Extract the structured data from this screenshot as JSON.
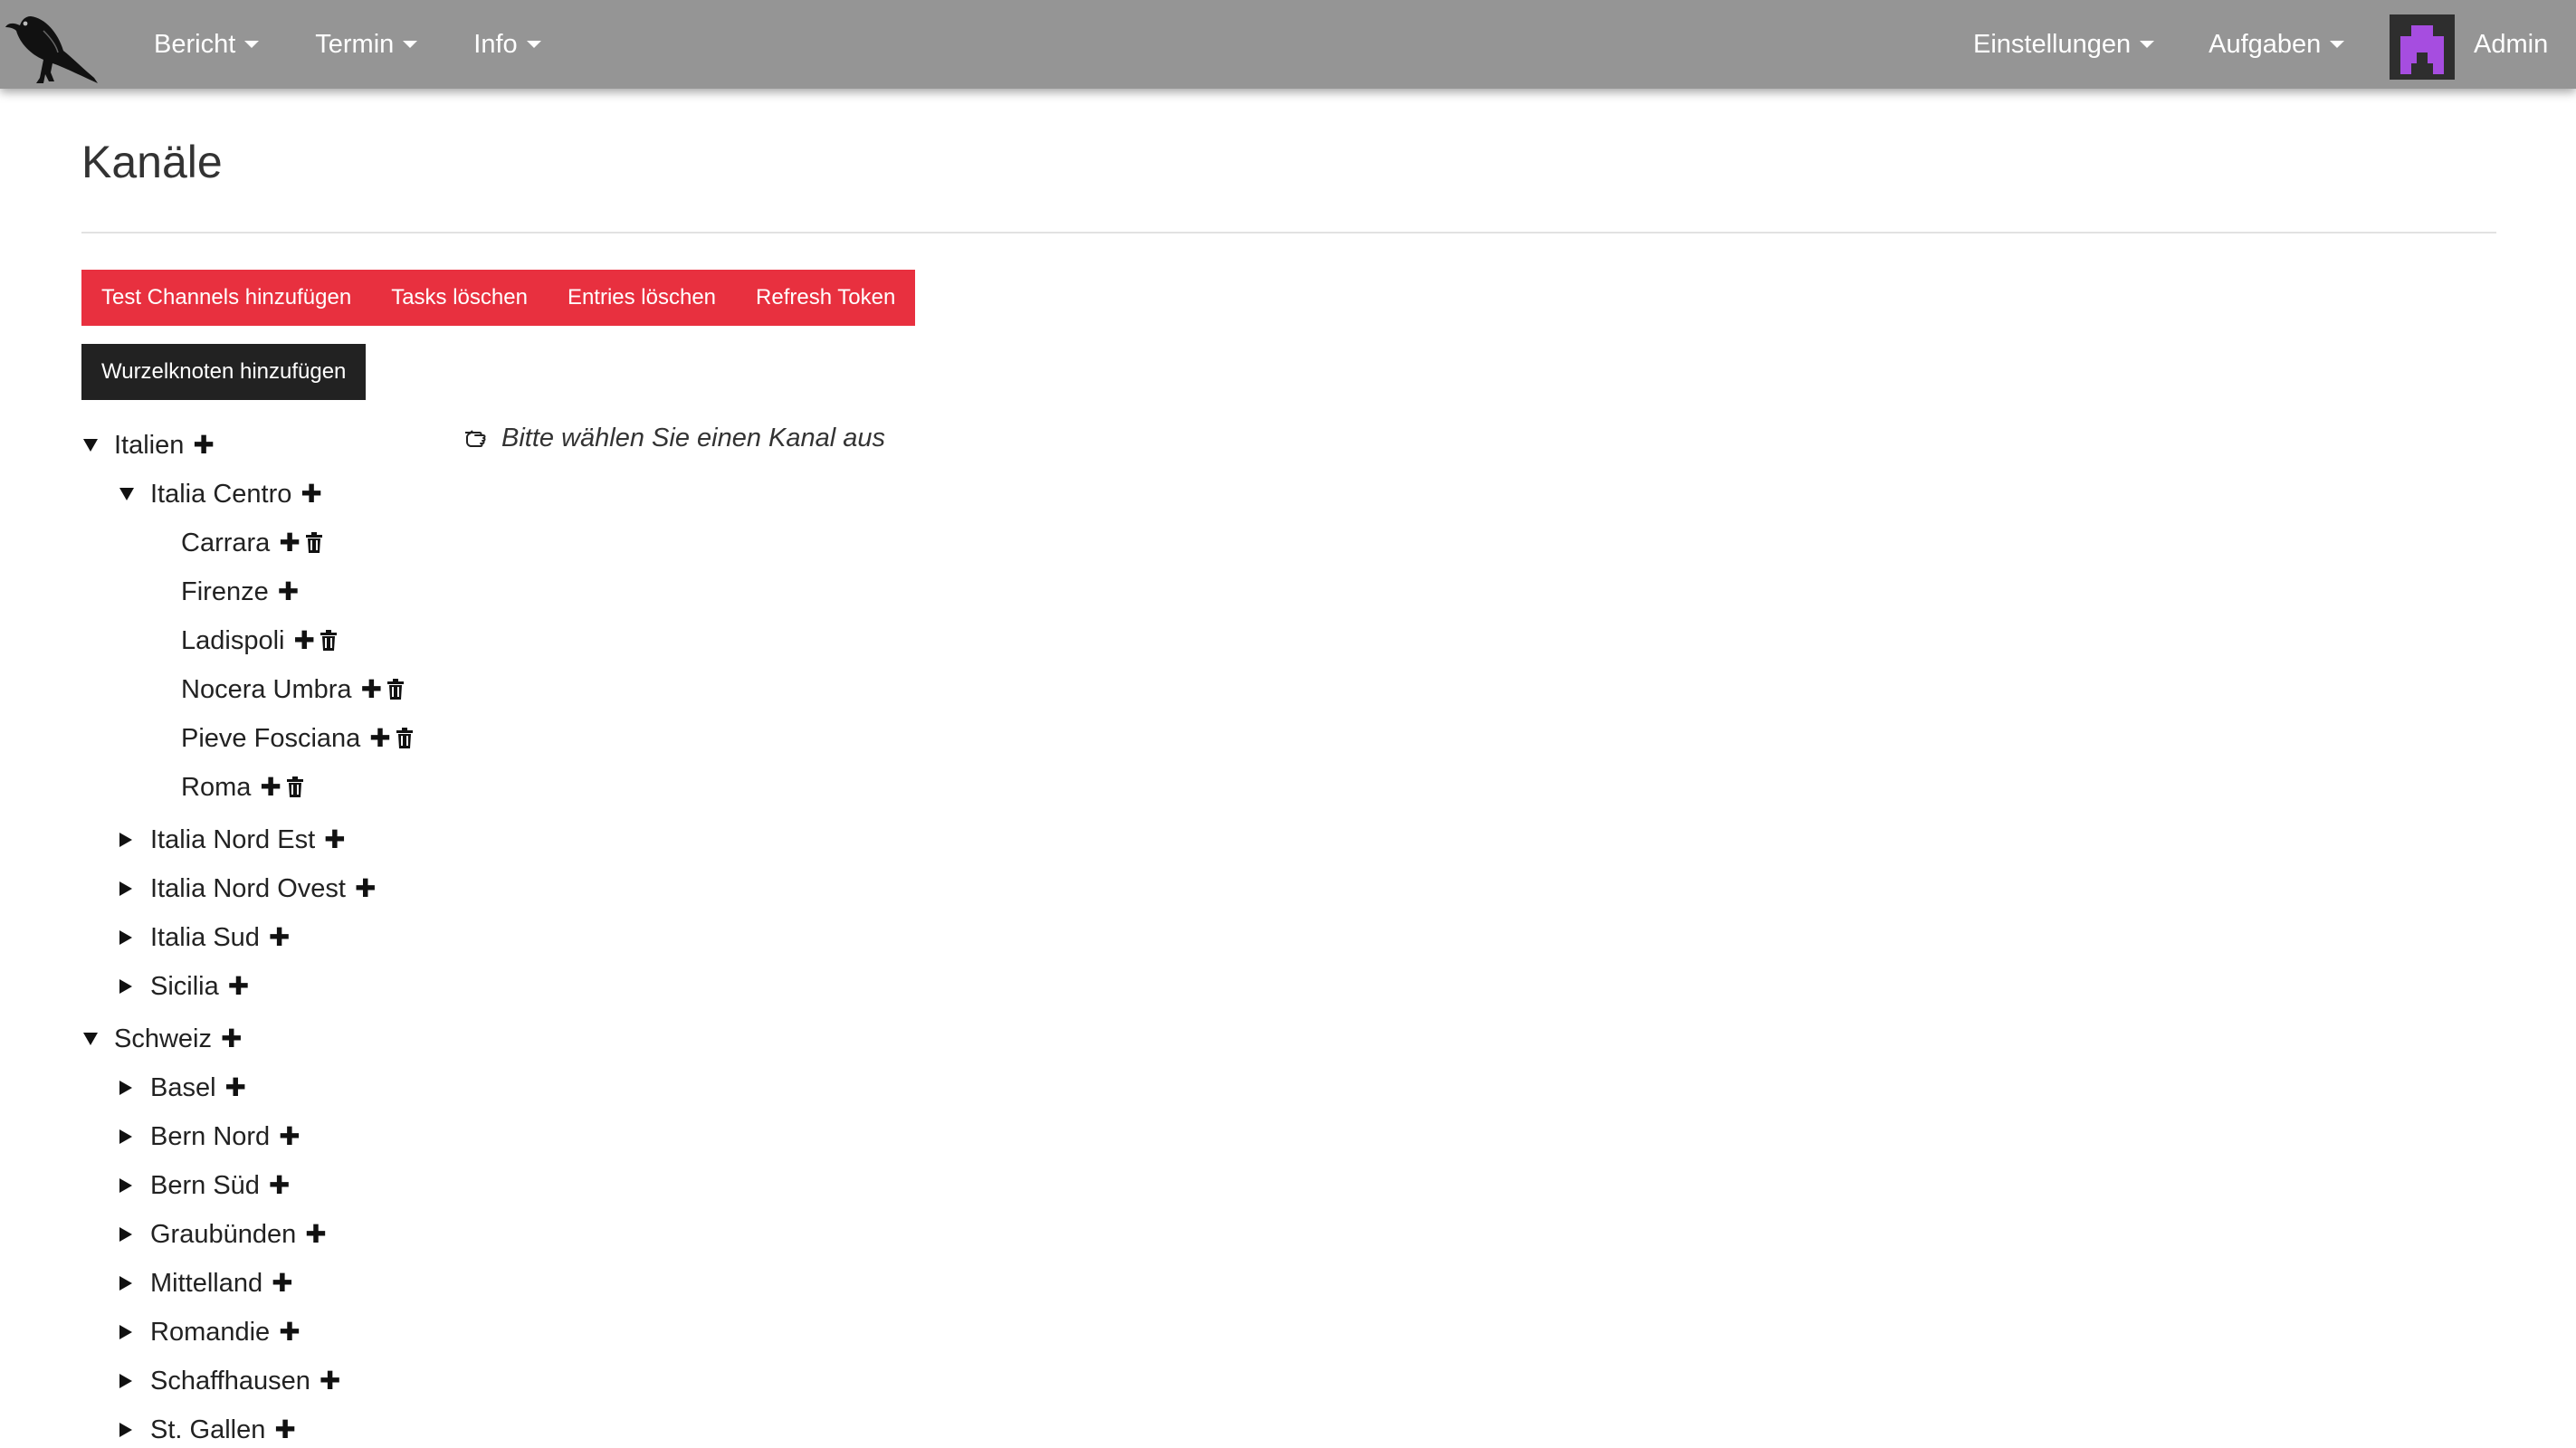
{
  "navbar": {
    "logo_icon": "raven-logo-icon",
    "menus_left": [
      {
        "label": "Bericht"
      },
      {
        "label": "Termin"
      },
      {
        "label": "Info"
      }
    ],
    "menus_right": [
      {
        "label": "Einstellungen"
      },
      {
        "label": "Aufgaben"
      }
    ],
    "user": {
      "name": "Admin",
      "avatar_icon": "pixel-avatar-icon",
      "avatar_color": "#a64de0"
    },
    "background_color": "#959595"
  },
  "page": {
    "title": "Kanäle"
  },
  "actions": {
    "buttons": [
      {
        "label": "Test Channels hinzufügen"
      },
      {
        "label": "Tasks löschen"
      },
      {
        "label": "Entries löschen"
      },
      {
        "label": "Refresh Token"
      }
    ],
    "button_color": "#e8303f",
    "add_root_label": "Wurzelknoten hinzufügen"
  },
  "tree": {
    "italien": {
      "label": "Italien",
      "expanded": true
    },
    "italia_centro": {
      "label": "Italia Centro",
      "expanded": true
    },
    "carrara": {
      "label": "Carrara"
    },
    "firenze": {
      "label": "Firenze"
    },
    "ladispoli": {
      "label": "Ladispoli"
    },
    "nocera_umbra": {
      "label": "Nocera Umbra"
    },
    "pieve_fosciana": {
      "label": "Pieve Fosciana"
    },
    "roma": {
      "label": "Roma"
    },
    "italia_nord_est": {
      "label": "Italia Nord Est",
      "expanded": false
    },
    "italia_nord_ovest": {
      "label": "Italia Nord Ovest",
      "expanded": false
    },
    "italia_sud": {
      "label": "Italia Sud",
      "expanded": false
    },
    "sicilia": {
      "label": "Sicilia",
      "expanded": false
    },
    "schweiz": {
      "label": "Schweiz",
      "expanded": true
    },
    "basel": {
      "label": "Basel",
      "expanded": false
    },
    "bern_nord": {
      "label": "Bern Nord",
      "expanded": false
    },
    "bern_sued": {
      "label": "Bern Süd",
      "expanded": false
    },
    "graubuenden": {
      "label": "Graubünden",
      "expanded": false
    },
    "mittelland": {
      "label": "Mittelland",
      "expanded": false
    },
    "romandie": {
      "label": "Romandie",
      "expanded": false
    },
    "schaffhausen": {
      "label": "Schaffhausen",
      "expanded": false
    },
    "st_gallen": {
      "label": "St. Gallen",
      "expanded": false
    }
  },
  "icons": {
    "add": "plus-icon",
    "delete": "trash-icon",
    "expand": "caret-down-icon",
    "collapse": "caret-right-icon",
    "hint": "pointing-hand-icon"
  },
  "hint": {
    "text": "Bitte wählen Sie einen Kanal aus"
  }
}
